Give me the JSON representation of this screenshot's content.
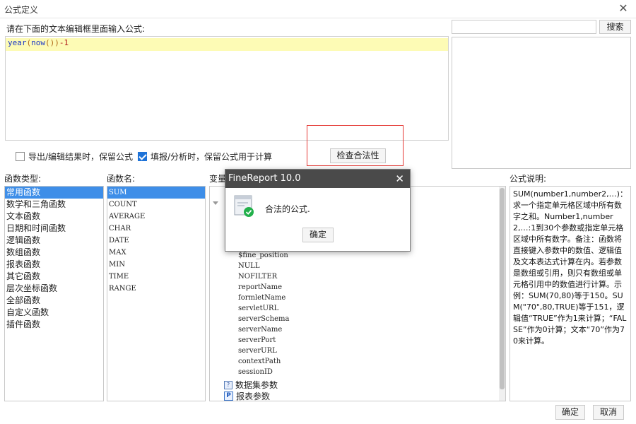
{
  "window": {
    "title": "公式定义"
  },
  "editor": {
    "prompt": "请在下面的文本编辑框里面输入公式:",
    "code": {
      "fn1": "year",
      "p1": "(",
      "fn2": "now",
      "p2": "())",
      "op": "-",
      "num": "1"
    }
  },
  "search": {
    "value": "",
    "placeholder": "",
    "button_label": "搜索"
  },
  "options": {
    "export_keep": {
      "label": "导出/编辑结果时，保留公式",
      "checked": false
    },
    "fill_keep": {
      "label": "填报/分析时，保留公式用于计算",
      "checked": true
    },
    "check_button": "检查合法性"
  },
  "panels": {
    "func_type_label": "函数类型:",
    "func_name_label": "函数名:",
    "variable_label": "变量",
    "desc_label": "公式说明:"
  },
  "func_types": [
    "常用函数",
    "数学和三角函数",
    "文本函数",
    "日期和时间函数",
    "逻辑函数",
    "数组函数",
    "报表函数",
    "其它函数",
    "层次坐标函数",
    "全部函数",
    "自定义函数",
    "插件函数"
  ],
  "func_names": [
    "SUM",
    "COUNT",
    "AVERAGE",
    "CHAR",
    "DATE",
    "MAX",
    "MIN",
    "TIME",
    "RANGE"
  ],
  "variables": [
    "$fine_position",
    "NULL",
    "NOFILTER",
    "reportName",
    "formletName",
    "servletURL",
    "serverSchema",
    "serverName",
    "serverPort",
    "serverURL",
    "contextPath",
    "sessionID"
  ],
  "tree_nodes": {
    "dataset_params": "数据集参数",
    "report_params": "报表参数"
  },
  "description": "SUM(number1,number2,…)：求一个指定单元格区域中所有数字之和。Number1,number2,…:1到30个参数或指定单元格区域中所有数字。备注：函数将直接键入参数中的数值、逻辑值及文本表达式计算在内。若参数是数组或引用，则只有数组或单元格引用中的数值进行计算。示例：SUM(70,80)等于150。SUM(\"70\",80,TRUE)等于151，逻辑值“TRUE”作为1来计算；“FALSE”作为0计算；文本“70”作为70来计算。",
  "buttons": {
    "ok": "确定",
    "cancel": "取消"
  },
  "modal": {
    "title": "FineReport 10.0",
    "message": "合法的公式.",
    "ok": "确定"
  },
  "colors": {
    "selection": "#3e8ee8",
    "highlight_line": "#fdfbb5",
    "check_frame": "#e53935",
    "modal_title_bg": "#4a4a4a"
  }
}
